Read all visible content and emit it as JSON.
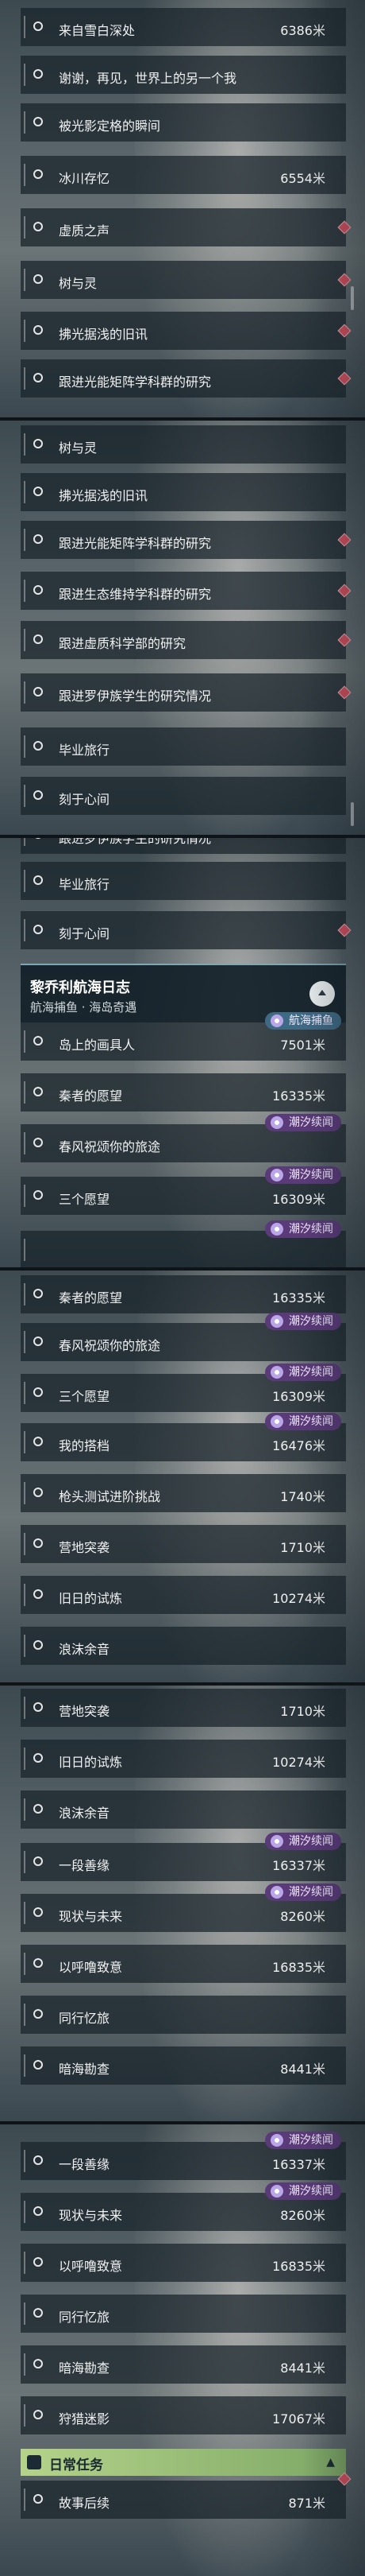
{
  "p1": [
    {
      "title": "来自雪白深处",
      "dist": "6386米"
    },
    {
      "title": "谢谢，再见，世界上的另一个我"
    },
    {
      "title": "被光影定格的瞬间"
    },
    {
      "title": "冰川存忆",
      "dist": "6554米"
    },
    {
      "title": "虚质之声"
    },
    {
      "title": "树与灵"
    },
    {
      "title": "拂光据浅的旧讯"
    },
    {
      "title": "跟进光能矩阵学科群的研究"
    }
  ],
  "p2": [
    {
      "title": "树与灵"
    },
    {
      "title": "拂光据浅的旧讯"
    },
    {
      "title": "跟进光能矩阵学科群的研究"
    },
    {
      "title": "跟进生态维持学科群的研究"
    },
    {
      "title": "跟进虚质科学部的研究"
    },
    {
      "title": "跟进罗伊族学生的研究情况"
    },
    {
      "title": "毕业旅行"
    },
    {
      "title": "刻于心间"
    }
  ],
  "p3": {
    "0": {
      "title": "跟进罗伊族学生的研究情况"
    },
    "1": {
      "title": "毕业旅行"
    },
    "2": {
      "title": "刻于心间"
    },
    "header": {
      "title": "黎乔利航海日志",
      "subtitle": "航海捕鱼 · 海岛奇遇"
    },
    "3": {
      "title": "岛上的画具人",
      "dist": "7501米",
      "badge": "航海捕鱼"
    },
    "4": {
      "title": "秦者的愿望",
      "dist": "16335米"
    },
    "5": {
      "title": "春风祝颂你的旅途",
      "badge": "潮汐续闻"
    },
    "6": {
      "title": "三个愿望",
      "dist": "16309米",
      "badge": "潮汐续闻"
    },
    "7": {
      "badge": "潮汐续闻"
    }
  },
  "p4": [
    {
      "title": "秦者的愿望",
      "dist": "16335米"
    },
    {
      "title": "春风祝颂你的旅途",
      "badge": "潮汐续闻"
    },
    {
      "title": "三个愿望",
      "dist": "16309米",
      "badge": "潮汐续闻"
    },
    {
      "title": "我的搭档",
      "dist": "16476米",
      "badge": "潮汐续闻"
    },
    {
      "title": "枪头测试进阶挑战",
      "dist": "1740米"
    },
    {
      "title": "营地突袭",
      "dist": "1710米"
    },
    {
      "title": "旧日的试炼",
      "dist": "10274米"
    },
    {
      "title": "浪沫余音"
    }
  ],
  "p5": [
    {
      "title": "营地突袭",
      "dist": "1710米"
    },
    {
      "title": "旧日的试炼",
      "dist": "10274米"
    },
    {
      "title": "浪沫余音"
    },
    {
      "title": "一段善缘",
      "dist": "16337米",
      "badge": "潮汐续闻"
    },
    {
      "title": "现状与未来",
      "dist": "8260米",
      "badge": "潮汐续闻"
    },
    {
      "title": "以呼噜致意",
      "dist": "16835米"
    },
    {
      "title": "同行忆旅"
    },
    {
      "title": "暗海勘查",
      "dist": "8441米"
    }
  ],
  "p6": {
    "0": {
      "title": "一段善缘",
      "dist": "16337米",
      "badge": "潮汐续闻"
    },
    "1": {
      "title": "现状与未来",
      "dist": "8260米",
      "badge": "潮汐续闻"
    },
    "2": {
      "title": "以呼噜致意",
      "dist": "16835米"
    },
    "3": {
      "title": "同行忆旅"
    },
    "4": {
      "title": "暗海勘查",
      "dist": "8441米"
    },
    "5": {
      "title": "狩猎迷影",
      "dist": "17067米"
    },
    "daily": {
      "title": "日常任务"
    },
    "6": {
      "title": "故事后续",
      "dist": "871米"
    }
  }
}
